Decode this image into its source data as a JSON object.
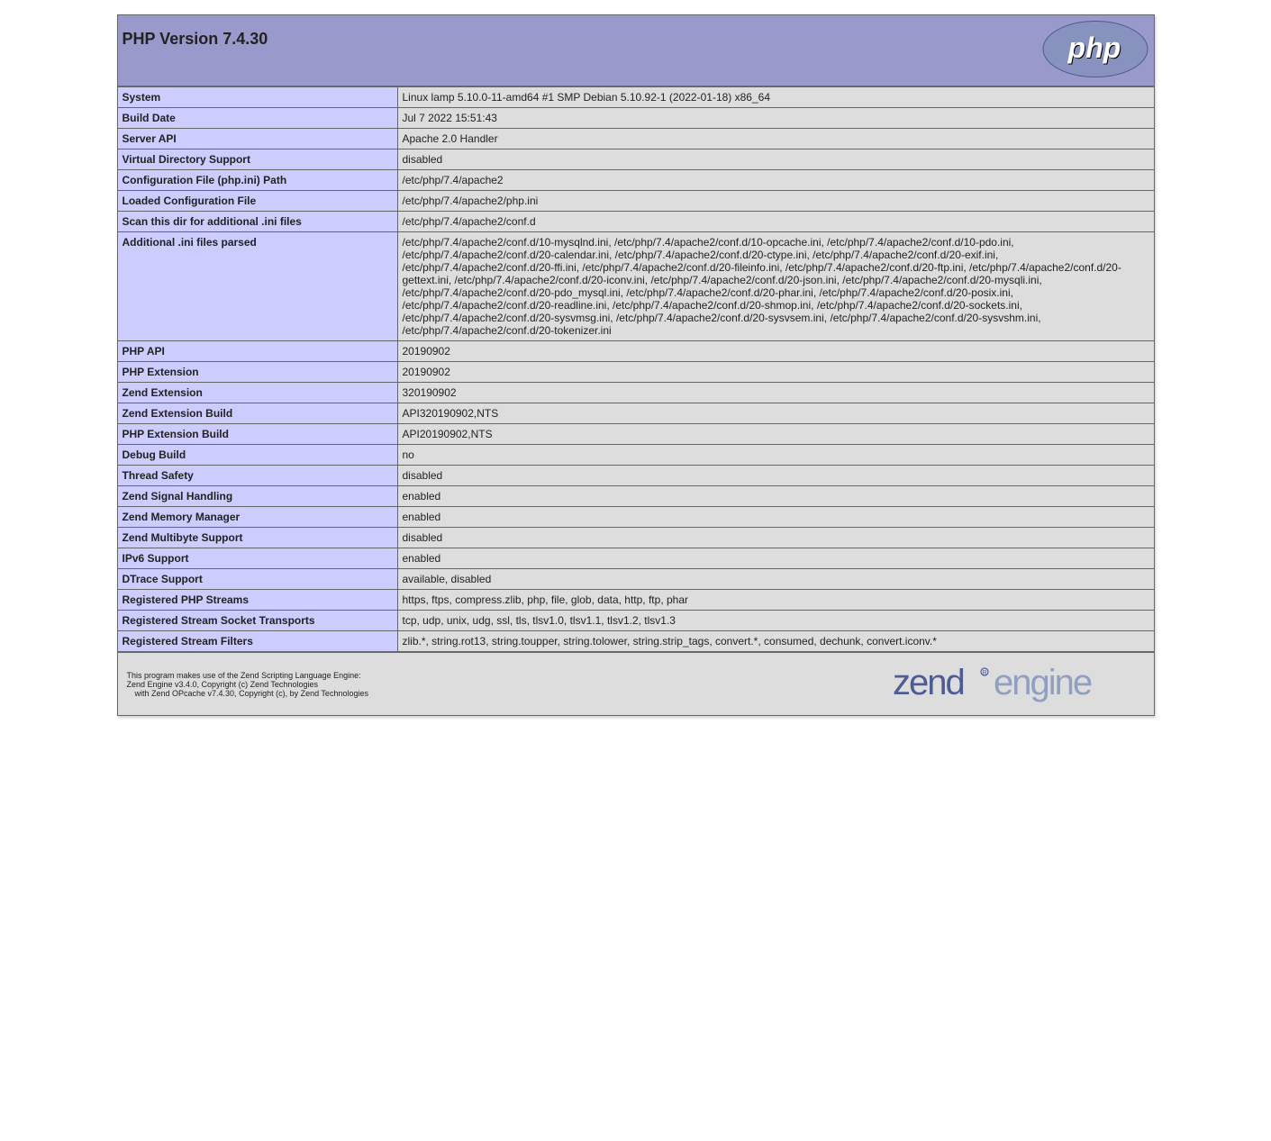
{
  "header": {
    "title": "PHP Version 7.4.30"
  },
  "info_rows": [
    {
      "label": "System",
      "value": "Linux lamp 5.10.0-11-amd64 #1 SMP Debian 5.10.92-1 (2022-01-18) x86_64"
    },
    {
      "label": "Build Date",
      "value": "Jul 7 2022 15:51:43"
    },
    {
      "label": "Server API",
      "value": "Apache 2.0 Handler"
    },
    {
      "label": "Virtual Directory Support",
      "value": "disabled"
    },
    {
      "label": "Configuration File (php.ini) Path",
      "value": "/etc/php/7.4/apache2"
    },
    {
      "label": "Loaded Configuration File",
      "value": "/etc/php/7.4/apache2/php.ini"
    },
    {
      "label": "Scan this dir for additional .ini files",
      "value": "/etc/php/7.4/apache2/conf.d"
    },
    {
      "label": "Additional .ini files parsed",
      "value": "/etc/php/7.4/apache2/conf.d/10-mysqlnd.ini, /etc/php/7.4/apache2/conf.d/10-opcache.ini, /etc/php/7.4/apache2/conf.d/10-pdo.ini, /etc/php/7.4/apache2/conf.d/20-calendar.ini, /etc/php/7.4/apache2/conf.d/20-ctype.ini, /etc/php/7.4/apache2/conf.d/20-exif.ini, /etc/php/7.4/apache2/conf.d/20-ffi.ini, /etc/php/7.4/apache2/conf.d/20-fileinfo.ini, /etc/php/7.4/apache2/conf.d/20-ftp.ini, /etc/php/7.4/apache2/conf.d/20-gettext.ini, /etc/php/7.4/apache2/conf.d/20-iconv.ini, /etc/php/7.4/apache2/conf.d/20-json.ini, /etc/php/7.4/apache2/conf.d/20-mysqli.ini, /etc/php/7.4/apache2/conf.d/20-pdo_mysql.ini, /etc/php/7.4/apache2/conf.d/20-phar.ini, /etc/php/7.4/apache2/conf.d/20-posix.ini, /etc/php/7.4/apache2/conf.d/20-readline.ini, /etc/php/7.4/apache2/conf.d/20-shmop.ini, /etc/php/7.4/apache2/conf.d/20-sockets.ini, /etc/php/7.4/apache2/conf.d/20-sysvmsg.ini, /etc/php/7.4/apache2/conf.d/20-sysvsem.ini, /etc/php/7.4/apache2/conf.d/20-sysvshm.ini, /etc/php/7.4/apache2/conf.d/20-tokenizer.ini"
    },
    {
      "label": "PHP API",
      "value": "20190902"
    },
    {
      "label": "PHP Extension",
      "value": "20190902"
    },
    {
      "label": "Zend Extension",
      "value": "320190902"
    },
    {
      "label": "Zend Extension Build",
      "value": "API320190902,NTS"
    },
    {
      "label": "PHP Extension Build",
      "value": "API20190902,NTS"
    },
    {
      "label": "Debug Build",
      "value": "no"
    },
    {
      "label": "Thread Safety",
      "value": "disabled"
    },
    {
      "label": "Zend Signal Handling",
      "value": "enabled"
    },
    {
      "label": "Zend Memory Manager",
      "value": "enabled"
    },
    {
      "label": "Zend Multibyte Support",
      "value": "disabled"
    },
    {
      "label": "IPv6 Support",
      "value": "enabled"
    },
    {
      "label": "DTrace Support",
      "value": "available, disabled"
    },
    {
      "label": "Registered PHP Streams",
      "value": "https, ftps, compress.zlib, php, file, glob, data, http, ftp, phar"
    },
    {
      "label": "Registered Stream Socket Transports",
      "value": "tcp, udp, unix, udg, ssl, tls, tlsv1.0, tlsv1.1, tlsv1.2, tlsv1.3"
    },
    {
      "label": "Registered Stream Filters",
      "value": "zlib.*, string.rot13, string.toupper, string.tolower, string.strip_tags, convert.*, consumed, dechunk, convert.iconv.*"
    }
  ],
  "zend": {
    "line1": "This program makes use of the Zend Scripting Language Engine:",
    "line2": "Zend Engine v3.4.0, Copyright (c) Zend Technologies",
    "line3": "with Zend OPcache v7.4.30, Copyright (c), by Zend Technologies"
  }
}
